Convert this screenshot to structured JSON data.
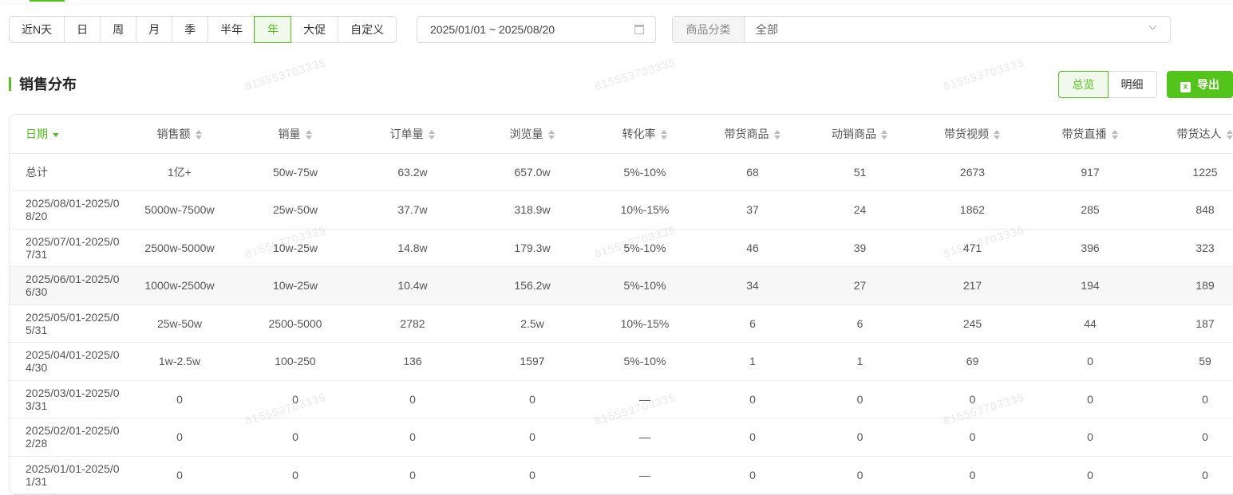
{
  "filters": {
    "periods": [
      "近N天",
      "日",
      "周",
      "月",
      "季",
      "半年",
      "年",
      "大促",
      "自定义"
    ],
    "active_period": "年",
    "date_range": "2025/01/01 ~ 2025/08/20",
    "category_label": "商品分类",
    "category_value": "全部"
  },
  "section": {
    "title": "销售分布",
    "view_overview": "总览",
    "view_detail": "明细",
    "export_label": "导出",
    "export_icon_text": "X"
  },
  "watermark": "815553703335",
  "table": {
    "headers": [
      "日期",
      "销售额",
      "销量",
      "订单量",
      "浏览量",
      "转化率",
      "带货商品",
      "动销商品",
      "带货视频",
      "带货直播",
      "带货达人"
    ],
    "rows": [
      [
        "总计",
        "1亿+",
        "50w-75w",
        "63.2w",
        "657.0w",
        "5%-10%",
        "68",
        "51",
        "2673",
        "917",
        "1225"
      ],
      [
        "2025/08/01-2025/08/20",
        "5000w-7500w",
        "25w-50w",
        "37.7w",
        "318.9w",
        "10%-15%",
        "37",
        "24",
        "1862",
        "285",
        "848"
      ],
      [
        "2025/07/01-2025/07/31",
        "2500w-5000w",
        "10w-25w",
        "14.8w",
        "179.3w",
        "5%-10%",
        "46",
        "39",
        "471",
        "396",
        "323"
      ],
      [
        "2025/06/01-2025/06/30",
        "1000w-2500w",
        "10w-25w",
        "10.4w",
        "156.2w",
        "5%-10%",
        "34",
        "27",
        "217",
        "194",
        "189"
      ],
      [
        "2025/05/01-2025/05/31",
        "25w-50w",
        "2500-5000",
        "2782",
        "2.5w",
        "10%-15%",
        "6",
        "6",
        "245",
        "44",
        "187"
      ],
      [
        "2025/04/01-2025/04/30",
        "1w-2.5w",
        "100-250",
        "136",
        "1597",
        "5%-10%",
        "1",
        "1",
        "69",
        "0",
        "59"
      ],
      [
        "2025/03/01-2025/03/31",
        "0",
        "0",
        "0",
        "0",
        "—",
        "0",
        "0",
        "0",
        "0",
        "0"
      ],
      [
        "2025/02/01-2025/02/28",
        "0",
        "0",
        "0",
        "0",
        "—",
        "0",
        "0",
        "0",
        "0",
        "0"
      ],
      [
        "2025/01/01-2025/01/31",
        "0",
        "0",
        "0",
        "0",
        "—",
        "0",
        "0",
        "0",
        "0",
        "0"
      ]
    ]
  }
}
